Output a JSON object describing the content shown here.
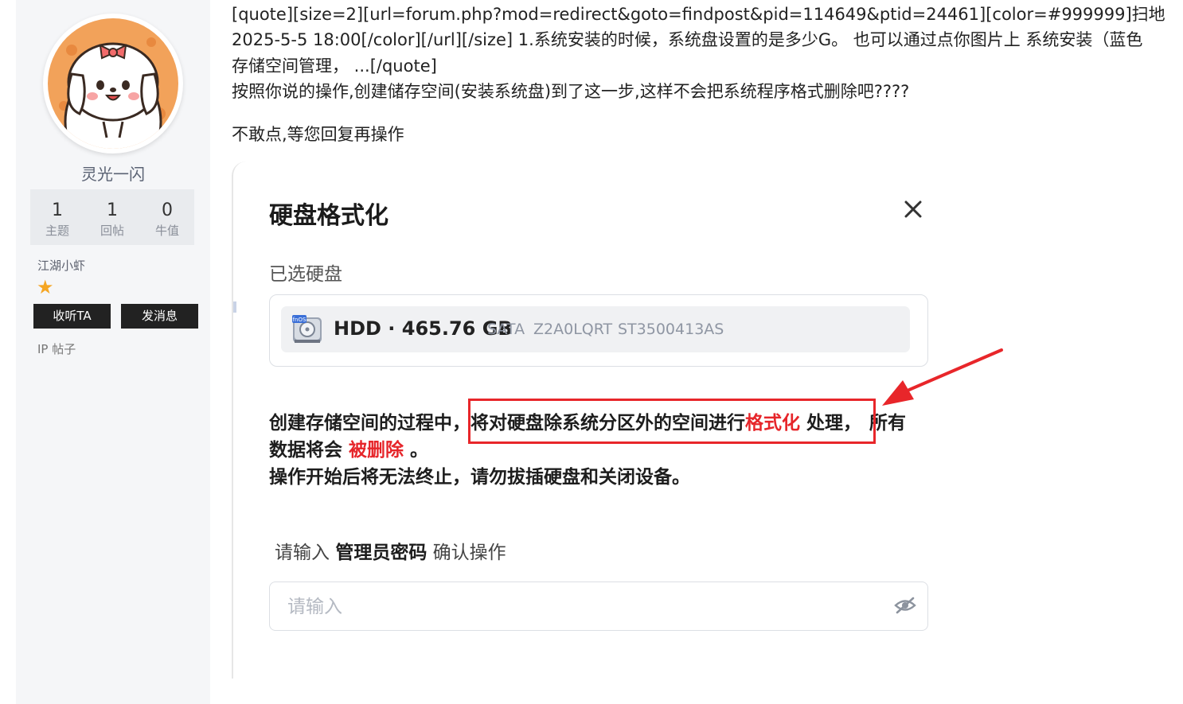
{
  "sidebar": {
    "username": "灵光一闪",
    "stats": [
      {
        "value": "1",
        "label": "主题"
      },
      {
        "value": "1",
        "label": "回帖"
      },
      {
        "value": "0",
        "label": "牛值"
      }
    ],
    "rank": "江湖小虾",
    "follow_label": "收听TA",
    "message_label": "发消息",
    "ip_label": "IP 帖子"
  },
  "post": {
    "lines": [
      "[quote][size=2][url=forum.php?mod=redirect&goto=findpost&pid=114649&ptid=24461][color=#999999]扫地",
      "2025-5-5 18:00[/color][/url][/size] 1.系统安装的时候，系统盘设置的是多少G。 也可以通过点你图片上 系统安装（蓝色",
      "存储空间管理，  ...[/quote]",
      "按照你说的操作,创建储存空间(安装系统盘)到了这一步,这样不会把系统程序格式删除吧????",
      "不敢点,等您回复再操作"
    ]
  },
  "dialog": {
    "title": "硬盘格式化",
    "selected_label": "已选硬盘",
    "disk": {
      "icon_text": "fnOS",
      "name": "HDD · 465.76 GB",
      "interface": "SATA",
      "serial": "Z2A0LQRT",
      "model": "ST3500413AS"
    },
    "warning": {
      "part1": "创建存储空间的过程中，",
      "part2": "将对硬盘除系统分区外的空间进行",
      "part3": "格式化",
      "part4": " 处理，",
      "part5": "所有",
      "part6": "数据将会",
      "part7": "被删除",
      "part8": " 。",
      "line3": "操作开始后将无法终止，请勿拔插硬盘和关闭设备。"
    },
    "password_label_pre": "请输入 ",
    "password_label_bold": "管理员密码",
    "password_label_post": " 确认操作",
    "password_placeholder": "请输入"
  },
  "colors": {
    "highlight_red": "#e8262a",
    "button_bg": "#222222",
    "star": "#f5a623"
  }
}
